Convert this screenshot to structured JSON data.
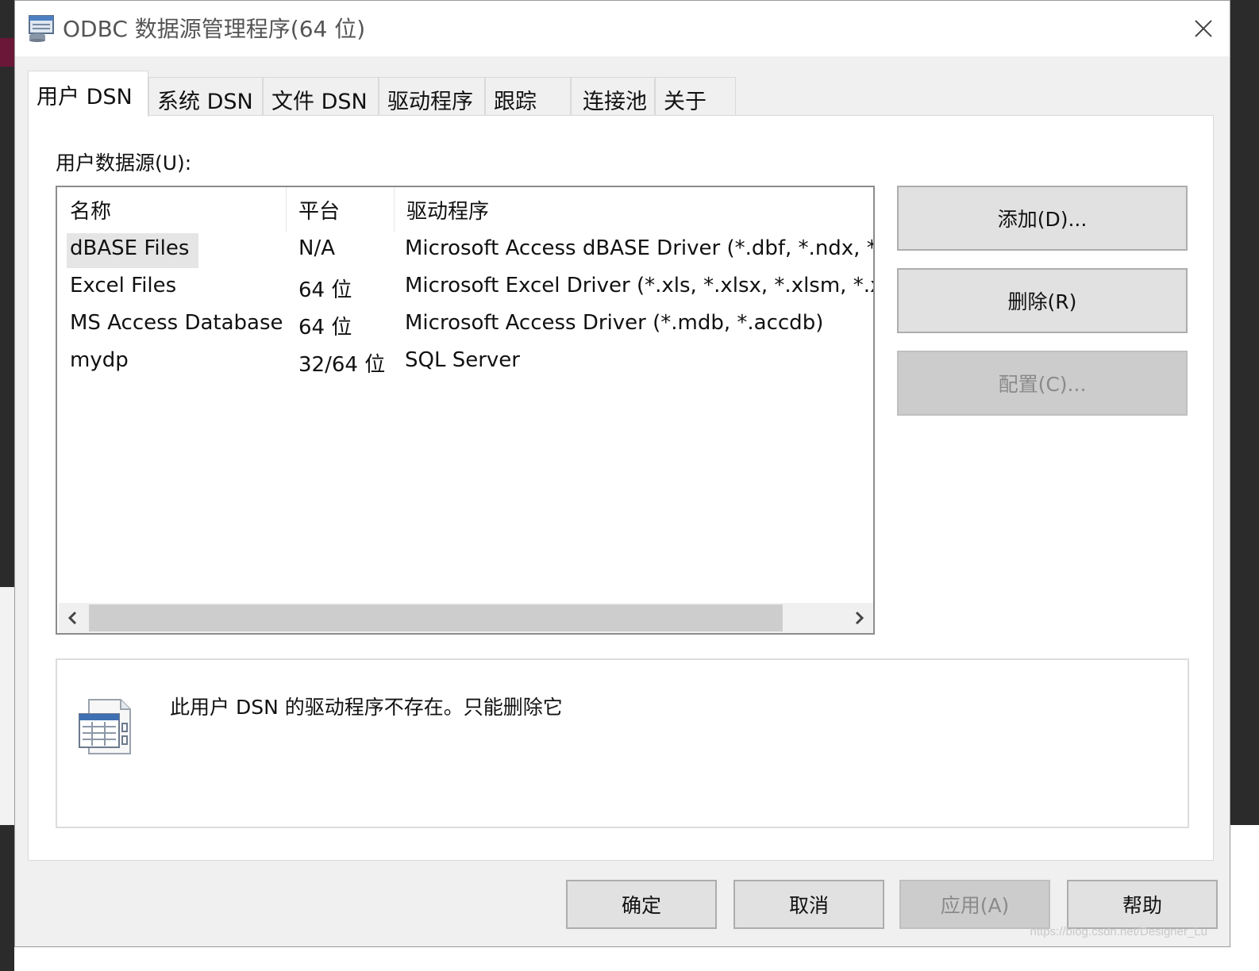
{
  "window": {
    "title": "ODBC 数据源管理程序(64 位)"
  },
  "tabs": [
    {
      "label": "用户 DSN",
      "active": true
    },
    {
      "label": "系统 DSN"
    },
    {
      "label": "文件 DSN"
    },
    {
      "label": "驱动程序"
    },
    {
      "label": "跟踪"
    },
    {
      "label": "连接池"
    },
    {
      "label": "关于"
    }
  ],
  "user_dsn": {
    "section_label": "用户数据源(U):",
    "columns": [
      "名称",
      "平台",
      "驱动程序"
    ],
    "rows": [
      {
        "name": "dBASE Files",
        "platform": "N/A",
        "driver": "Microsoft Access dBASE Driver (*.dbf, *.ndx, *.mdx)"
      },
      {
        "name": "Excel Files",
        "platform": "64 位",
        "driver": "Microsoft Excel Driver (*.xls, *.xlsx, *.xlsm, *.xlsb)"
      },
      {
        "name": "MS Access Database",
        "platform": "64 位",
        "driver": "Microsoft Access Driver (*.mdb, *.accdb)"
      },
      {
        "name": "mydp",
        "platform": "32/64 位",
        "driver": "SQL Server"
      }
    ],
    "buttons": {
      "add": "添加(D)...",
      "remove": "删除(R)",
      "configure": "配置(C)..."
    },
    "info_text": "此用户 DSN 的驱动程序不存在。只能删除它"
  },
  "footer": {
    "ok": "确定",
    "cancel": "取消",
    "apply": "应用(A)",
    "help": "帮助"
  },
  "watermark": "https://blog.csdn.net/Designer_Lu"
}
